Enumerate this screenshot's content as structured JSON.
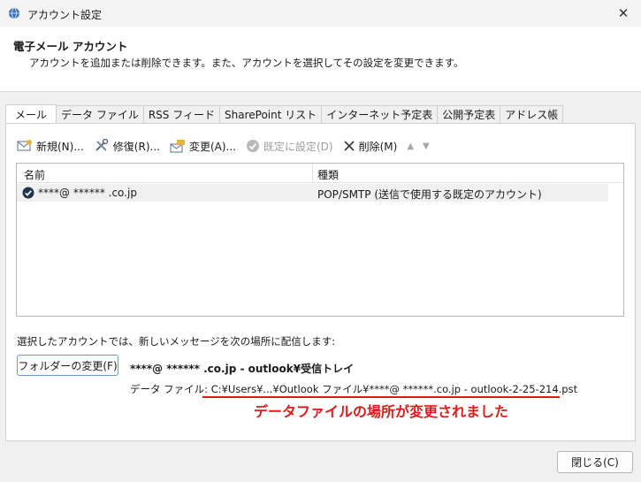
{
  "window": {
    "title": "アカウント設定",
    "close_glyph": "✕"
  },
  "header": {
    "title": "電子メール アカウント",
    "description": "アカウントを追加または削除できます。また、アカウントを選択してその設定を変更できます。"
  },
  "tabs": [
    {
      "label": "メール",
      "active": true
    },
    {
      "label": "データ ファイル"
    },
    {
      "label": "RSS フィード"
    },
    {
      "label": "SharePoint リスト"
    },
    {
      "label": "インターネット予定表"
    },
    {
      "label": "公開予定表"
    },
    {
      "label": "アドレス帳"
    }
  ],
  "toolbar": {
    "new_label": "新規(N)...",
    "repair_label": "修復(R)...",
    "change_label": "変更(A)...",
    "default_label": "既定に設定(D)",
    "delete_label": "削除(M)",
    "up_glyph": "▲",
    "down_glyph": "▼"
  },
  "accounts_table": {
    "columns": [
      "名前",
      "種類"
    ],
    "rows": [
      {
        "name": "****@ ****** .co.jp",
        "type": "POP/SMTP (送信で使用する既定のアカウント)"
      }
    ]
  },
  "delivery": {
    "label": "選択したアカウントでは、新しいメッセージを次の場所に配信します:",
    "change_folder_label": "フォルダーの変更(F)",
    "folder_path": "****@ ****** .co.jp - outlook¥受信トレイ",
    "data_file_label": "データ ファイル: ",
    "data_file_path": "C:¥Users¥...¥Outlook ファイル¥****@ ******.co.jp - outlook-2-25-214.pst"
  },
  "annotation": {
    "text": "データファイルの場所が変更されました",
    "color": "#e01b1b"
  },
  "footer": {
    "close_label": "閉じる(C)"
  }
}
